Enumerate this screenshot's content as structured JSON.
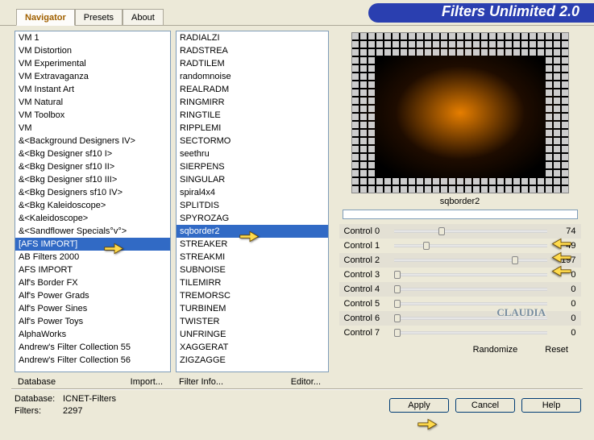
{
  "app_title": "Filters Unlimited 2.0",
  "tabs": [
    "Navigator",
    "Presets",
    "About"
  ],
  "active_tab": 0,
  "categories": [
    "VM 1",
    "VM Distortion",
    "VM Experimental",
    "VM Extravaganza",
    "VM Instant Art",
    "VM Natural",
    "VM Toolbox",
    "VM",
    "&<Background Designers IV>",
    "&<Bkg Designer sf10 I>",
    "&<Bkg Designer sf10 II>",
    "&<Bkg Designer sf10 III>",
    "&<Bkg Designers sf10 IV>",
    "&<Bkg Kaleidoscope>",
    "&<Kaleidoscope>",
    "&<Sandflower Specials°v°>",
    "[AFS IMPORT]",
    "AB Filters 2000",
    "AFS IMPORT",
    "Alf's Border FX",
    "Alf's Power Grads",
    "Alf's Power Sines",
    "Alf's Power Toys",
    "AlphaWorks",
    "Andrew's Filter Collection 55",
    "Andrew's Filter Collection 56"
  ],
  "selected_category_index": 16,
  "filters": [
    "RADIALZI",
    "RADSTREA",
    "RADTILEM",
    "randomnoise",
    "REALRADM",
    "RINGMIRR",
    "RINGTILE",
    "RIPPLEMI",
    "SECTORMO",
    "seethru",
    "SIERPENS",
    "SINGULAR",
    "spiral4x4",
    "SPLITDIS",
    "SPYROZAG",
    "sqborder2",
    "STREAKER",
    "STREAKMI",
    "SUBNOISE",
    "TILEMIRR",
    "TREMORSC",
    "TURBINEM",
    "TWISTER",
    "UNFRINGE",
    "XAGGERAT",
    "ZIGZAGGE"
  ],
  "selected_filter_index": 15,
  "preview_label": "sqborder2",
  "controls": [
    {
      "label": "Control 0",
      "value": 74,
      "max": 255
    },
    {
      "label": "Control 1",
      "value": 49,
      "max": 255
    },
    {
      "label": "Control 2",
      "value": 197,
      "max": 255
    },
    {
      "label": "Control 3",
      "value": 0,
      "max": 255
    },
    {
      "label": "Control 4",
      "value": 0,
      "max": 255
    },
    {
      "label": "Control 5",
      "value": 0,
      "max": 255
    },
    {
      "label": "Control 6",
      "value": 0,
      "max": 255
    },
    {
      "label": "Control 7",
      "value": 0,
      "max": 255
    }
  ],
  "links": {
    "database": "Database",
    "import": "Import...",
    "filter_info": "Filter Info...",
    "editor": "Editor...",
    "randomize": "Randomize",
    "reset": "Reset"
  },
  "footer": {
    "db_label": "Database:",
    "db_value": "ICNET-Filters",
    "filters_label": "Filters:",
    "filters_value": "2297",
    "apply": "Apply",
    "cancel": "Cancel",
    "help": "Help"
  },
  "watermark": "CLAUDIA"
}
